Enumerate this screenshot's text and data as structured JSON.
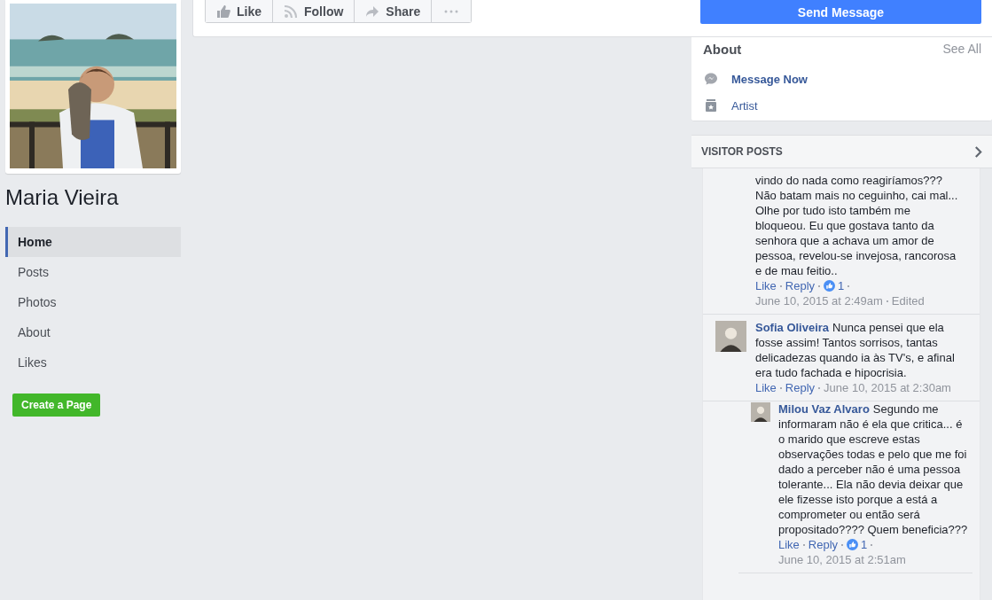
{
  "profile": {
    "name": "Maria Vieira"
  },
  "nav": [
    {
      "label": "Home",
      "selected": true
    },
    {
      "label": "Posts",
      "selected": false
    },
    {
      "label": "Photos",
      "selected": false
    },
    {
      "label": "About",
      "selected": false
    },
    {
      "label": "Likes",
      "selected": false
    }
  ],
  "create_page_button": "Create a Page",
  "actions": [
    {
      "kind": "like",
      "label": "Like"
    },
    {
      "kind": "follow",
      "label": "Follow"
    },
    {
      "kind": "share",
      "label": "Share"
    },
    {
      "kind": "more"
    }
  ],
  "send_message_button": "Send Message",
  "about": {
    "title": "About",
    "see_all": "See All",
    "items": [
      {
        "kind": "messenger",
        "label": "Message Now"
      },
      {
        "kind": "category",
        "label": "Artist"
      }
    ]
  },
  "visitor_posts": {
    "title": "VISITOR POSTS",
    "comments": [
      {
        "text": "vindo do nada como reagiríamos??? Não batam mais no ceguinho, cai mal... Olhe por tudo isto também me bloqueou. Eu que gostava tanto da senhora que a achava um amor de pessoa, revelou-se invejosa, rancorosa e de mau feitio..",
        "like": "Like",
        "reply": "Reply",
        "reactions": "1",
        "date": "June 10, 2015 at 2:49am",
        "edited": "Edited"
      },
      {
        "author": "Sofia Oliveira",
        "text": "Nunca pensei que ela fosse assim! Tantos sorrisos, tantas delicadezas quando ia às TV's, e afinal era tudo fachada e hipocrisia.",
        "like": "Like",
        "reply": "Reply",
        "date": "June 10, 2015 at 2:30am",
        "children": [
          {
            "author": "Milou Vaz Alvaro",
            "text": "Segundo me informaram não é ela que critica... é o marido que escreve estas observações todas e pelo que me foi dado a perceber não é uma pessoa tolerante... Ela não devia deixar que ele fizesse isto porque a está a comprometer ou então será propositado???? Quem beneficia???",
            "like": "Like",
            "reply": "Reply",
            "reactions": "1",
            "date": "June 10, 2015 at 2:51am"
          }
        ]
      }
    ]
  }
}
